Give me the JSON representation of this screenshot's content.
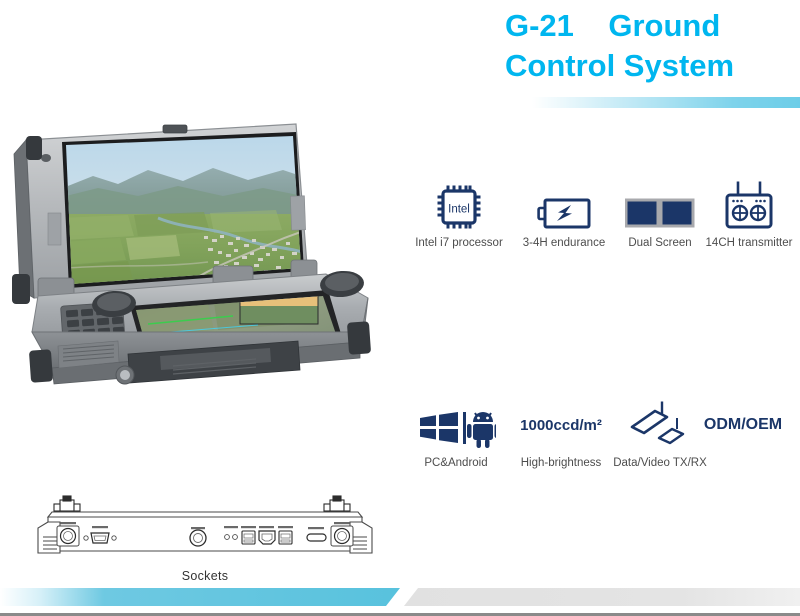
{
  "title": {
    "line1": "G-21    Ground",
    "line2": "Control System",
    "color": "#00b6ef"
  },
  "product": {
    "name": "G-21 rugged ground control station laptop",
    "screen_content": "aerial landscape photo of green fields, town and mountains",
    "lower_screen_content": "aerial map view with flight telemetry overlay"
  },
  "features": {
    "accent_color": "#1b3668",
    "label_color": "#4d4d4d",
    "row1": [
      {
        "icon": "intel-chip-icon",
        "icon_text": "Intel",
        "label": "Intel i7 processor"
      },
      {
        "icon": "battery-charging-icon",
        "label": "3-4H endurance"
      },
      {
        "icon": "dual-monitor-icon",
        "label": "Dual Screen"
      },
      {
        "icon": "rc-transmitter-icon",
        "label": "14CH transmitter"
      }
    ],
    "row2": [
      {
        "icon": "windows-android-icon",
        "label": "PC&Android"
      },
      {
        "icon": "brightness-text-icon",
        "icon_text": "1000ccd/m²",
        "label": "High-brightness"
      },
      {
        "icon": "transceiver-modules-icon",
        "label": "Data/Video TX/RX"
      },
      {
        "icon": "odm-oem-text-icon",
        "icon_text": "ODM/OEM",
        "label": ""
      }
    ]
  },
  "sockets": {
    "caption": "Sockets",
    "description": "line drawing of rear connector panel",
    "ports": [
      "antenna-connector-left",
      "antenna-connector-right",
      "circular-connector-left",
      "circular-connector-right",
      "db-serial-port",
      "round-jack-port",
      "usb-port-group",
      "ethernet-port",
      "micro-hdmi-port"
    ]
  },
  "decor": {
    "cyan": "#58c2dd",
    "gray": "#e2e2e2",
    "rule": "#8a8a8a"
  }
}
